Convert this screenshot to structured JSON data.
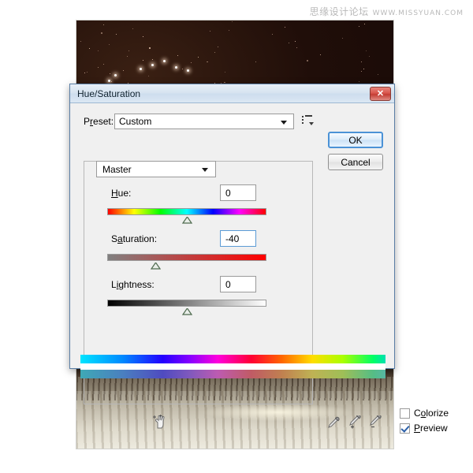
{
  "watermark": {
    "cn": "思缘设计论坛",
    "url": "WWW.MISSYUAN.COM"
  },
  "dialog": {
    "title": "Hue/Saturation",
    "close_label": "✕",
    "preset": {
      "label": "Preset:",
      "label_pre": "P",
      "label_mnemonic": "r",
      "label_post": "eset:",
      "value": "Custom",
      "menu_icon": "preset-options-icon"
    },
    "buttons": {
      "ok": "OK",
      "cancel": "Cancel"
    },
    "channel": {
      "value": "Master"
    },
    "sliders": [
      {
        "name": "hue",
        "label_pre": "",
        "label_mnemonic": "H",
        "label_post": "ue:",
        "label": "Hue:",
        "value": "0",
        "thumb_pct": 50,
        "focused": false,
        "range": [
          -180,
          180
        ]
      },
      {
        "name": "saturation",
        "label_pre": "S",
        "label_mnemonic": "a",
        "label_post": "turation:",
        "label": "Saturation:",
        "value": "-40",
        "thumb_pct": 30,
        "focused": true,
        "range": [
          -100,
          100
        ]
      },
      {
        "name": "lightness",
        "label_pre": "L",
        "label_mnemonic": "i",
        "label_post": "ghtness:",
        "label": "Lightness:",
        "value": "0",
        "thumb_pct": 50,
        "focused": false,
        "range": [
          -100,
          100
        ]
      }
    ],
    "checkboxes": [
      {
        "name": "colorize",
        "label": "Colorize",
        "label_pre": "C",
        "label_mnemonic": "o",
        "label_post": "lorize",
        "checked": false
      },
      {
        "name": "preview",
        "label": "Preview",
        "label_pre": "",
        "label_mnemonic": "P",
        "label_post": "review",
        "checked": true
      }
    ],
    "tools": {
      "hand_icon": "on-image-adjustment-hand-icon",
      "eyedroppers": [
        "eyedropper-icon",
        "eyedropper-plus-icon",
        "eyedropper-minus-icon"
      ]
    }
  },
  "colors": {
    "dialog_bg": "#f0f0f0",
    "titlebar_bg": "#d6e3f0",
    "dialog_border": "#5b7fa6",
    "ok_border": "#4b92d6",
    "close_bg": "#d8564c",
    "focus_border": "#5b9bd5",
    "checkmark": "#2b5fa8"
  }
}
